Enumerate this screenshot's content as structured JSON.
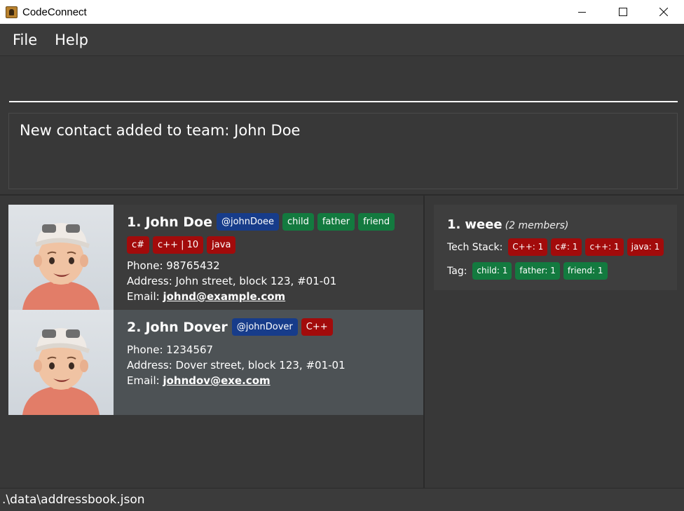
{
  "window": {
    "title": "CodeConnect",
    "minimize_symbol": "minimize",
    "maximize_symbol": "maximize",
    "close_symbol": "close"
  },
  "menu": {
    "file": "File",
    "help": "Help"
  },
  "command": {
    "value": "",
    "placeholder": ""
  },
  "result": {
    "message": "New contact added to team: John Doe"
  },
  "persons": [
    {
      "index": "1.",
      "name": "John Doe",
      "github": "@johnDoee",
      "tags": [
        "child",
        "father",
        "friend"
      ],
      "tech": [
        "c#",
        "c++ | 10",
        "java"
      ],
      "phone": "Phone: 98765432",
      "address": "Address: John street, block 123, #01-01",
      "email_label": "Email: ",
      "email": "johnd@example.com"
    },
    {
      "index": "2.",
      "name": "John Dover",
      "github": "@johnDover",
      "tags": [],
      "tech": [
        "C++"
      ],
      "phone": "Phone: 1234567",
      "address": "Address: Dover street, block 123, #01-01",
      "email_label": "Email: ",
      "email": "johndov@exe.com"
    }
  ],
  "teams": [
    {
      "index": "1.",
      "name": "weee",
      "members": "(2 members)",
      "tech_label": "Tech Stack:",
      "tech": [
        "C++: 1",
        "c#: 1",
        "c++: 1",
        "java: 1"
      ],
      "tag_label": "Tag:",
      "tags": [
        "child: 1",
        "father: 1",
        "friend: 1"
      ]
    }
  ],
  "status": {
    "path": ".\\data\\addressbook.json"
  },
  "colors": {
    "github_chip": "#173c8a",
    "tag_chip": "#137a3f",
    "tech_chip": "#a20b0b",
    "background": "#383838"
  }
}
